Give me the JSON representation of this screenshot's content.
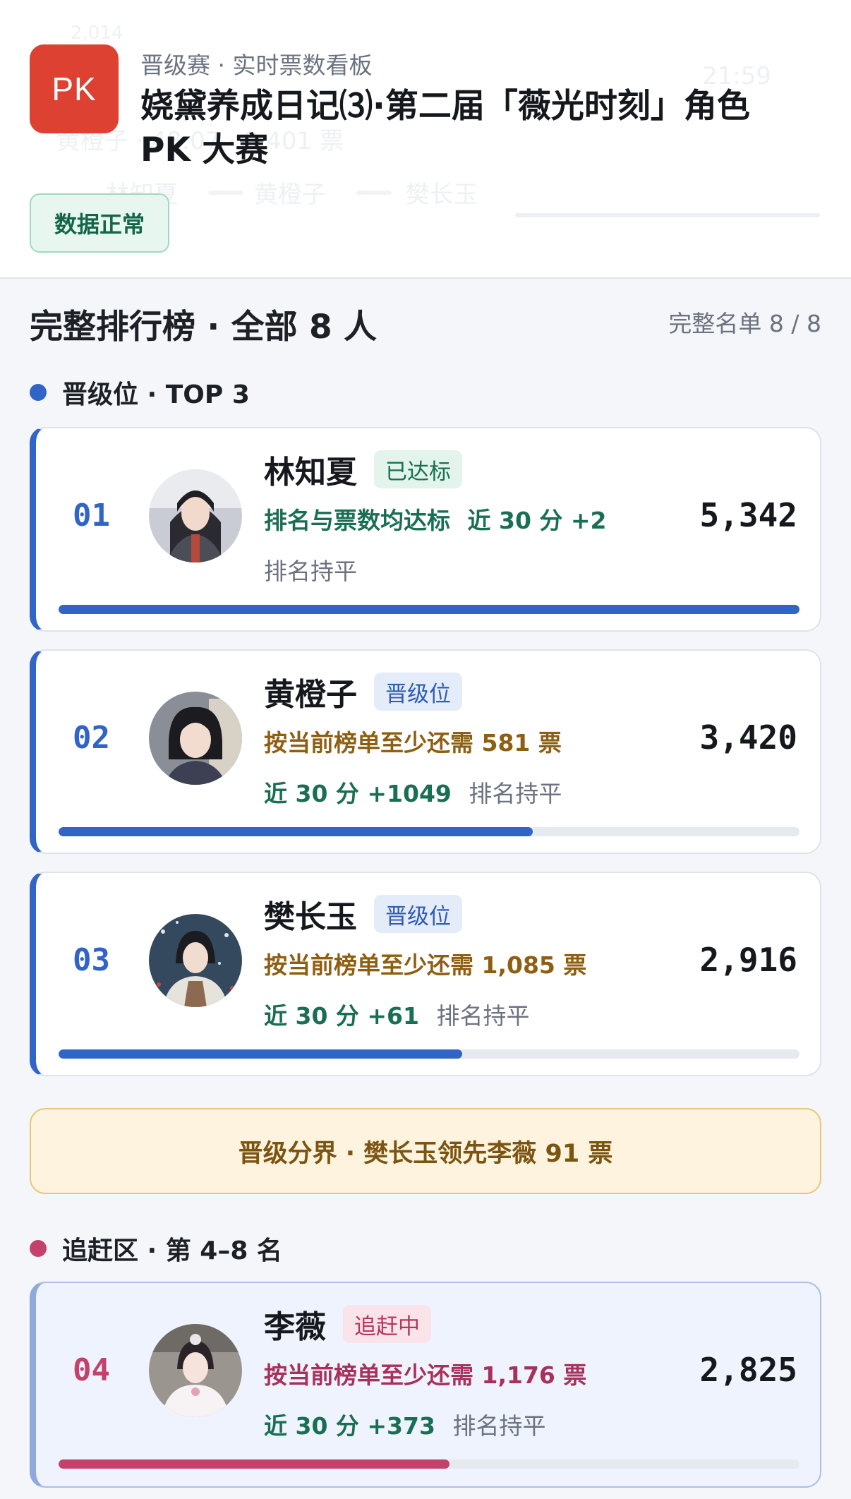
{
  "header": {
    "logo": "PK",
    "subtitle": "晋级赛 · 实时票数看板",
    "title": "娆黛养成日记⑶·第二届「薇光时刻」角色 PK 大赛",
    "status": "数据正常",
    "background_fragments": {
      "time": "21:59",
      "year": "2,014",
      "stats": "黄橙子 · 48:07 · 8,401 票",
      "legend": [
        "林知夏",
        "黄橙子",
        "樊长玉"
      ]
    }
  },
  "section": {
    "title": "完整排行榜 · 全部 8 人",
    "count": "完整名单 8 / 8"
  },
  "groups": {
    "top": {
      "label": "晋级位 · TOP 3",
      "color": "#3164c7"
    },
    "chase": {
      "label": "追赶区 · 第 4–8 名",
      "color": "#c4416b"
    }
  },
  "boundary": {
    "text": "晋级分界 · 樊长玉领先李薇 91 票"
  },
  "cards": [
    {
      "rank": "01",
      "name": "林知夏",
      "tag": "已达标",
      "line1_main": "排名与票数均达标",
      "line1_extra": "近 30 分 +2",
      "line2_main": "",
      "line2_extra": "排名持平",
      "votes": "5,342",
      "progress": 1.0
    },
    {
      "rank": "02",
      "name": "黄橙子",
      "tag": "晋级位",
      "line1_main": "按当前榜单至少还需 581 票",
      "line1_extra": "",
      "line2_main": "近 30 分 +1049",
      "line2_extra": "排名持平",
      "votes": "3,420",
      "progress": 0.64
    },
    {
      "rank": "03",
      "name": "樊长玉",
      "tag": "晋级位",
      "line1_main": "按当前榜单至少还需 1,085 票",
      "line1_extra": "",
      "line2_main": "近 30 分 +61",
      "line2_extra": "排名持平",
      "votes": "2,916",
      "progress": 0.545
    },
    {
      "rank": "04",
      "name": "李薇",
      "tag": "追赶中",
      "line1_main": "按当前榜单至少还需 1,176 票",
      "line1_extra": "",
      "line2_main": "近 30 分 +373",
      "line2_extra": "排名持平",
      "votes": "2,825",
      "progress": 0.528
    }
  ]
}
